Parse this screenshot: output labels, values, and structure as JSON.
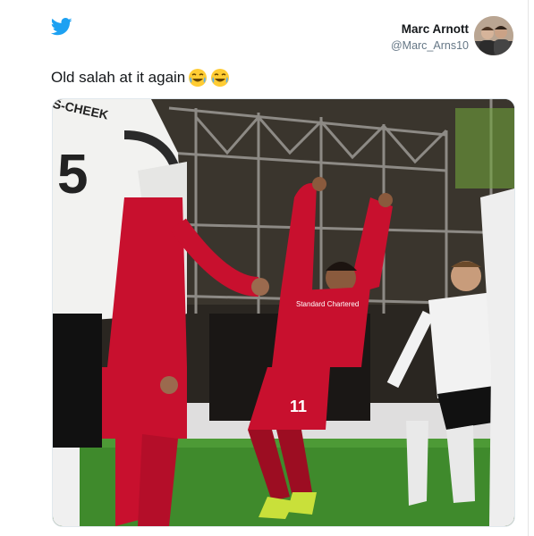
{
  "tweet": {
    "author_name": "Marc Arnott",
    "author_handle": "@Marc_Arns10",
    "text": "Old salah at it again",
    "emojis": [
      "face-with-tears-of-joy",
      "face-with-tears-of-joy"
    ]
  },
  "media": {
    "description_icon": "photo",
    "jersey_back_text": "S-CHEEK",
    "jersey_back_number": "5",
    "shorts_number": "11",
    "sponsor_text": "Standard Chartered"
  },
  "colors": {
    "twitter_blue": "#1da1f2",
    "liverpool_red": "#c8102e",
    "pitch_green": "#3f8a2c"
  }
}
